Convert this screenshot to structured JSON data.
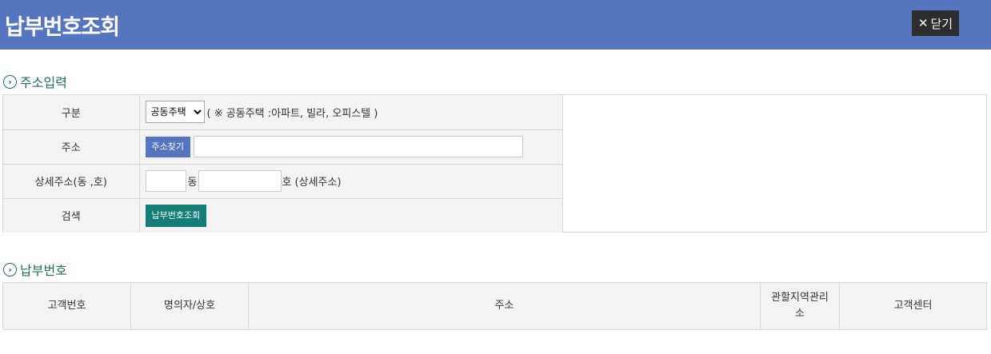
{
  "header": {
    "title": "납부번호조회",
    "close_label": "닫기"
  },
  "address_section": {
    "title": "주소입력",
    "rows": {
      "type_label": "구분",
      "type_selected": "공동주택",
      "type_hint": "( ※ 공동주택 :아파트, 빌라, 오피스텔 )",
      "address_label": "주소",
      "find_button": "주소찾기",
      "address_value": "",
      "detail_label": "상세주소(동 ,호)",
      "dong_value": "",
      "dong_suffix": "동",
      "ho_value": "",
      "ho_suffix": "호 (상세주소)",
      "search_label": "검색",
      "search_button": "납부번호조회"
    }
  },
  "payment_section": {
    "title": "납부번호",
    "columns": [
      "고객번호",
      "명의자/상호",
      "주소",
      "관할지역관리소",
      "고객센터"
    ]
  },
  "colors": {
    "header_bg": "#5576be",
    "accent_green": "#137d76",
    "section_title": "#1f6b5e"
  }
}
